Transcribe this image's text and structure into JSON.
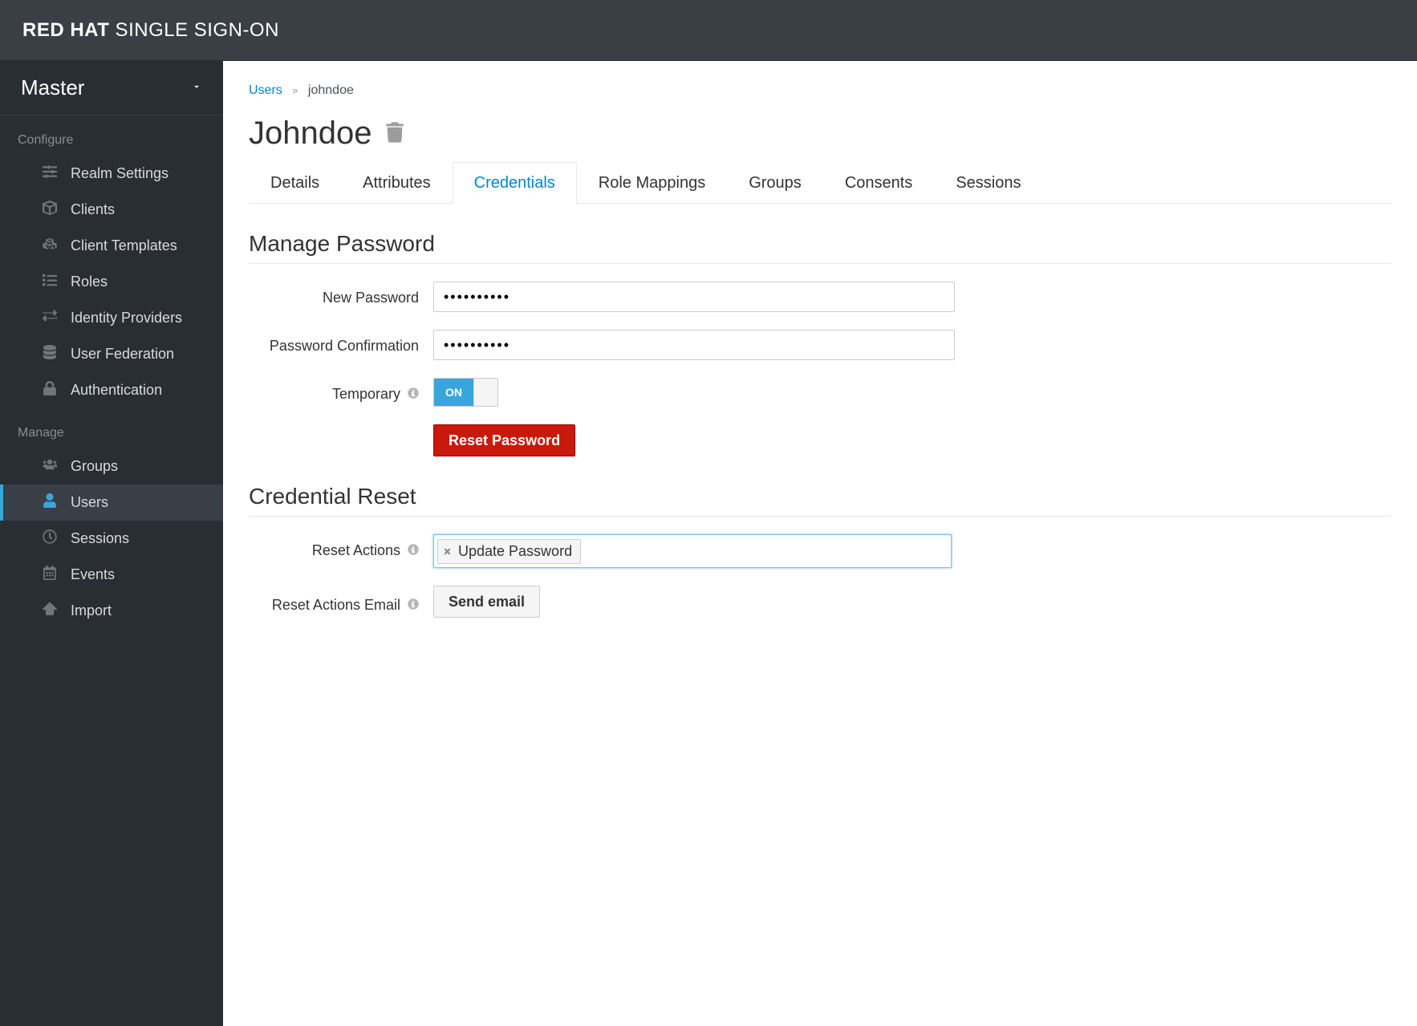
{
  "brand": {
    "strong": "RED HAT",
    "rest": " SINGLE SIGN-ON"
  },
  "realm": "Master",
  "sidebar": {
    "configure_label": "Configure",
    "manage_label": "Manage",
    "configure": [
      {
        "label": "Realm Settings",
        "name": "sidebar-item-realm-settings",
        "icon": "sliders-icon"
      },
      {
        "label": "Clients",
        "name": "sidebar-item-clients",
        "icon": "cube-icon"
      },
      {
        "label": "Client Templates",
        "name": "sidebar-item-client-templates",
        "icon": "cubes-icon"
      },
      {
        "label": "Roles",
        "name": "sidebar-item-roles",
        "icon": "list-icon"
      },
      {
        "label": "Identity Providers",
        "name": "sidebar-item-identity-providers",
        "icon": "exchange-icon"
      },
      {
        "label": "User Federation",
        "name": "sidebar-item-user-federation",
        "icon": "database-icon"
      },
      {
        "label": "Authentication",
        "name": "sidebar-item-authentication",
        "icon": "lock-icon"
      }
    ],
    "manage": [
      {
        "label": "Groups",
        "name": "sidebar-item-groups",
        "icon": "users-icon"
      },
      {
        "label": "Users",
        "name": "sidebar-item-users",
        "icon": "user-icon",
        "active": true
      },
      {
        "label": "Sessions",
        "name": "sidebar-item-sessions",
        "icon": "clock-icon"
      },
      {
        "label": "Events",
        "name": "sidebar-item-events",
        "icon": "calendar-icon"
      },
      {
        "label": "Import",
        "name": "sidebar-item-import",
        "icon": "import-icon"
      }
    ]
  },
  "breadcrumb": {
    "parent": "Users",
    "current": "johndoe"
  },
  "page_title": "Johndoe",
  "tabs": [
    {
      "label": "Details",
      "name": "tab-details"
    },
    {
      "label": "Attributes",
      "name": "tab-attributes"
    },
    {
      "label": "Credentials",
      "name": "tab-credentials",
      "active": true
    },
    {
      "label": "Role Mappings",
      "name": "tab-role-mappings"
    },
    {
      "label": "Groups",
      "name": "tab-groups"
    },
    {
      "label": "Consents",
      "name": "tab-consents"
    },
    {
      "label": "Sessions",
      "name": "tab-sessions"
    }
  ],
  "sections": {
    "manage_password": "Manage Password",
    "credential_reset": "Credential Reset"
  },
  "form": {
    "new_password_label": "New Password",
    "new_password_value": "••••••••••",
    "confirm_label": "Password Confirmation",
    "confirm_value": "••••••••••",
    "temporary_label": "Temporary",
    "temporary_on": "ON",
    "reset_password_btn": "Reset Password",
    "reset_actions_label": "Reset Actions",
    "reset_actions_tag": "Update Password",
    "reset_actions_email_label": "Reset Actions Email",
    "send_email_btn": "Send email"
  }
}
